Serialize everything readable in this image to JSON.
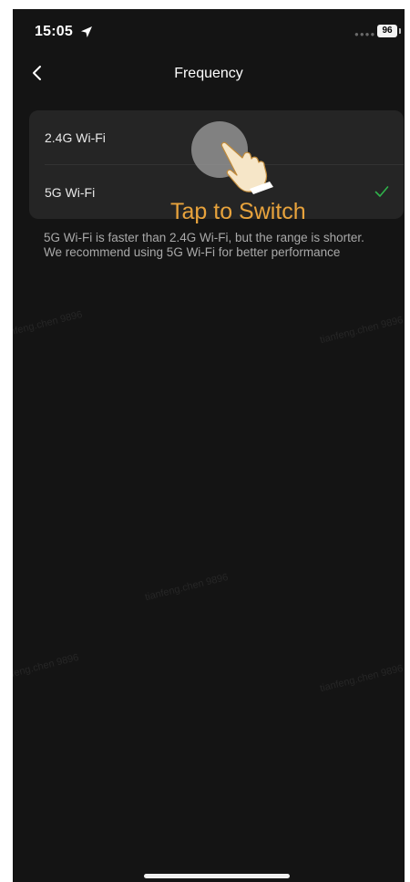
{
  "status_bar": {
    "time": "15:05",
    "battery": "96",
    "location_icon": "location-arrow-icon"
  },
  "nav": {
    "title": "Frequency",
    "back_icon": "chevron-left-icon"
  },
  "options": [
    {
      "label": "2.4G Wi-Fi",
      "selected": false
    },
    {
      "label": "5G Wi-Fi",
      "selected": true
    }
  ],
  "description": "5G Wi-Fi is faster than 2.4G Wi-Fi, but the range is shorter. We recommend using 5G Wi-Fi for better performance",
  "tap_hint": "Tap to Switch",
  "watermark": "tianfeng.chen 9896",
  "colors": {
    "background": "#141414",
    "card": "#252525",
    "accent_check": "#2fb24a",
    "tap_hint": "#e8a33c"
  }
}
